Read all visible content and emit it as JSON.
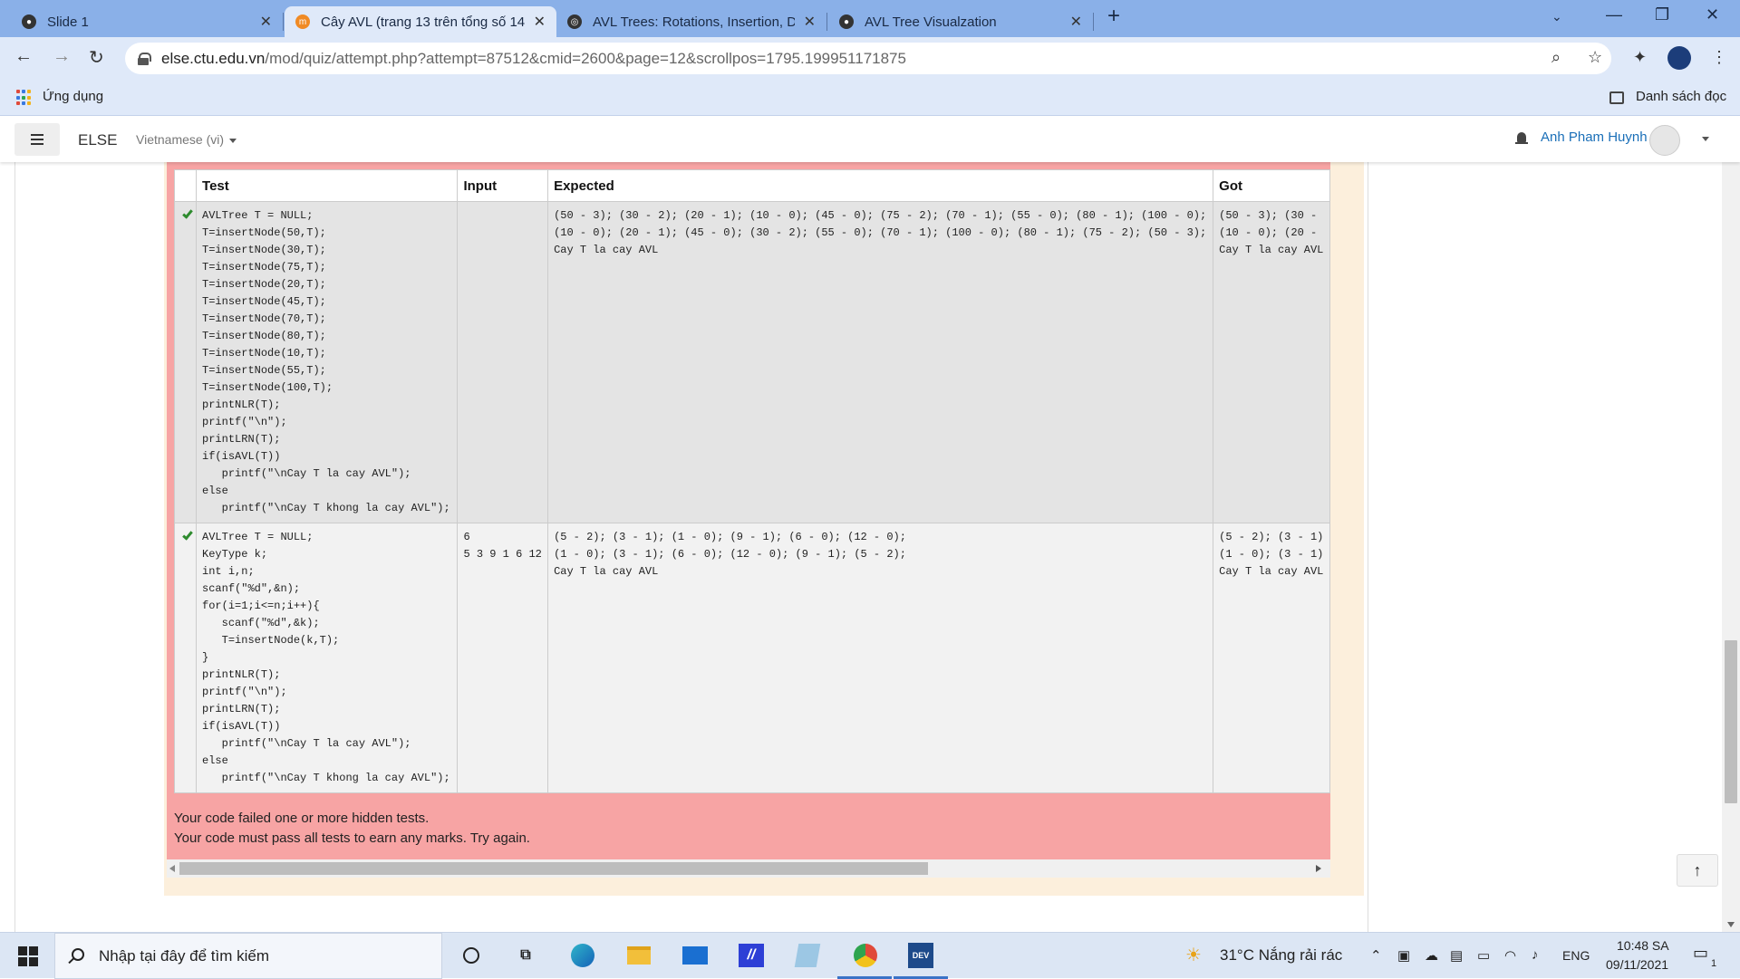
{
  "browser": {
    "tabs": [
      {
        "title": "Slide 1",
        "active": false
      },
      {
        "title": "Cây AVL (trang 13 trên tổng số 14",
        "active": true
      },
      {
        "title": "AVL Trees: Rotations, Insertion, D",
        "active": false
      },
      {
        "title": "AVL Tree Visualzation",
        "active": false
      }
    ],
    "url_host": "else.ctu.edu.vn",
    "url_path": "/mod/quiz/attempt.php?attempt=87512&cmid=2600&page=12&scrollpos=1795.199951171875",
    "bookmarks": {
      "apps_label": "Ứng dụng",
      "reading_list_label": "Danh sách đọc"
    }
  },
  "moodle": {
    "site_name": "ELSE",
    "language": "Vietnamese (vi)",
    "user_name": "Anh Pham Huynh"
  },
  "results": {
    "columns": [
      "Test",
      "Input",
      "Expected",
      "Got"
    ],
    "rows": [
      {
        "passed": true,
        "test": "AVLTree T = NULL;\nT=insertNode(50,T);\nT=insertNode(30,T);\nT=insertNode(75,T);\nT=insertNode(20,T);\nT=insertNode(45,T);\nT=insertNode(70,T);\nT=insertNode(80,T);\nT=insertNode(10,T);\nT=insertNode(55,T);\nT=insertNode(100,T);\nprintNLR(T);\nprintf(\"\\n\");\nprintLRN(T);\nif(isAVL(T))\n   printf(\"\\nCay T la cay AVL\");\nelse\n   printf(\"\\nCay T khong la cay AVL\");",
        "input": "",
        "expected": "(50 - 3); (30 - 2); (20 - 1); (10 - 0); (45 - 0); (75 - 2); (70 - 1); (55 - 0); (80 - 1); (100 - 0);\n(10 - 0); (20 - 1); (45 - 0); (30 - 2); (55 - 0); (70 - 1); (100 - 0); (80 - 1); (75 - 2); (50 - 3);\nCay T la cay AVL",
        "got": "(50 - 3); (30 -\n(10 - 0); (20 -\nCay T la cay AVL"
      },
      {
        "passed": true,
        "test": "AVLTree T = NULL;\nKeyType k;\nint i,n;\nscanf(\"%d\",&n);\nfor(i=1;i<=n;i++){\n   scanf(\"%d\",&k);\n   T=insertNode(k,T);\n}\nprintNLR(T);\nprintf(\"\\n\");\nprintLRN(T);\nif(isAVL(T))\n   printf(\"\\nCay T la cay AVL\");\nelse\n   printf(\"\\nCay T khong la cay AVL\");",
        "input": "6\n5 3 9 1 6 12",
        "expected": "(5 - 2); (3 - 1); (1 - 0); (9 - 1); (6 - 0); (12 - 0);\n(1 - 0); (3 - 1); (6 - 0); (12 - 0); (9 - 1); (5 - 2);\nCay T la cay AVL",
        "got": "(5 - 2); (3 - 1)\n(1 - 0); (3 - 1)\nCay T la cay AVL"
      }
    ],
    "fail_line1": "Your code failed one or more hidden tests.",
    "fail_line2": "Your code must pass all tests to earn any marks. Try again."
  },
  "taskbar": {
    "search_placeholder": "Nhập tại đây để tìm kiếm",
    "weather": "31°C  Nắng rải rác",
    "language": "ENG",
    "time": "10:48 SA",
    "date": "09/11/2021",
    "notification_count": "1"
  }
}
